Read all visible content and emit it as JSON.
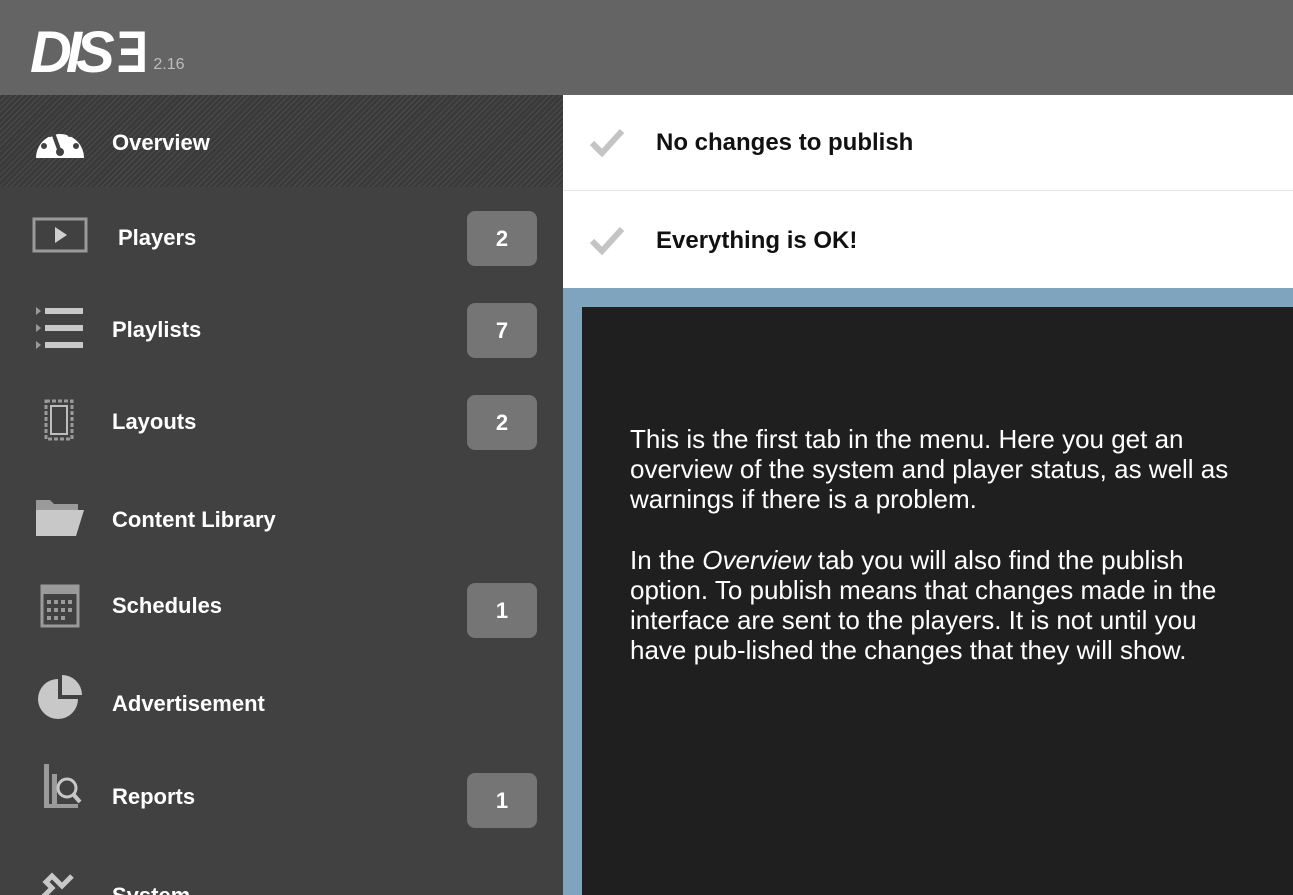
{
  "header": {
    "logo_text": "DIS",
    "logo_glyph": "Ǝ",
    "version": "2.16"
  },
  "sidebar": {
    "items": [
      {
        "label": "Overview",
        "icon": "gauge-icon",
        "badge": null,
        "active": true
      },
      {
        "label": "Players",
        "icon": "play-screen-icon",
        "badge": "2"
      },
      {
        "label": "Playlists",
        "icon": "list-icon",
        "badge": "7"
      },
      {
        "label": "Layouts",
        "icon": "layout-icon",
        "badge": "2"
      },
      {
        "label": "Content Library",
        "icon": "folder-icon",
        "badge": null
      },
      {
        "label": "Schedules",
        "icon": "calendar-icon",
        "badge": "1"
      },
      {
        "label": "Advertisement",
        "icon": "pie-chart-icon",
        "badge": null
      },
      {
        "label": "Reports",
        "icon": "report-magnifier-icon",
        "badge": "1"
      },
      {
        "label": "System",
        "icon": "wrench-icon",
        "badge": null
      }
    ]
  },
  "status": {
    "publish": "No changes to publish",
    "health": "Everything is OK!"
  },
  "tooltip": {
    "para1": "This is the first tab in the menu. Here you get an overview of the system and player status, as well as warnings if there is a problem.",
    "para2_before": "In the ",
    "para2_em": "Overview",
    "para2_after": " tab you will also find the publish option. To publish means that changes made in the interface are sent to the players. It is not until you have pub-lished the changes that they will show."
  },
  "colors": {
    "topbar": "#646464",
    "sidebar": "#414141",
    "badge": "#757575",
    "tooltip_frame": "#7fa4bd",
    "tooltip_bg": "#1f1f1f"
  }
}
